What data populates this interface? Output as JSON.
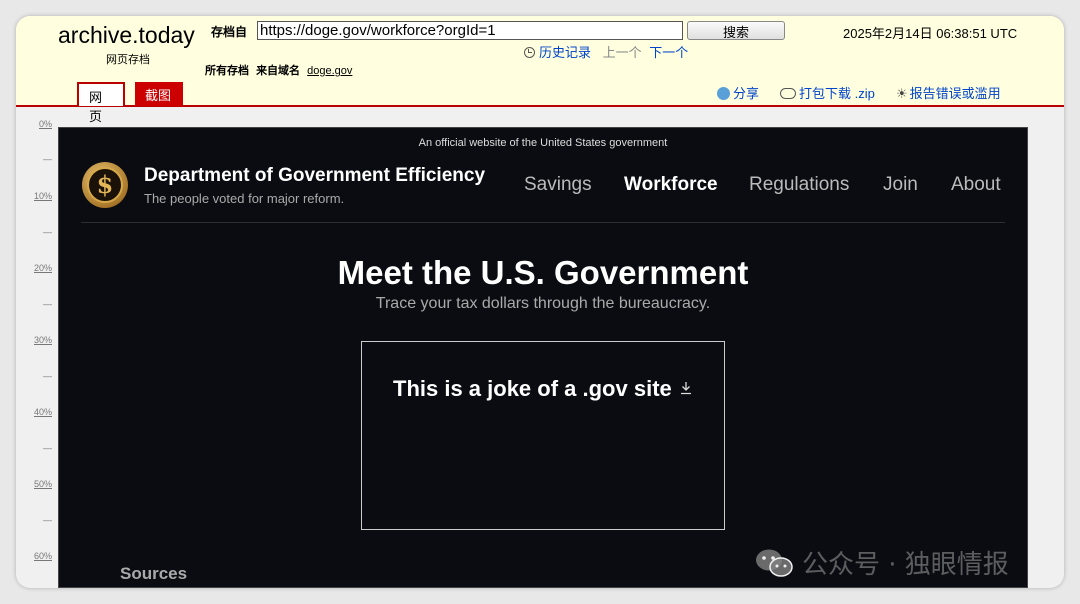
{
  "archive": {
    "brand": "archive.today",
    "brand_sub": "网页存档",
    "from_label": "存档自",
    "url": "https://doge.gov/workforce?orgId=1",
    "search_label": "搜索",
    "timestamp": "2025年2月14日 06:38:51 UTC",
    "history_label": "历史记录",
    "prev_label": "上一个",
    "next_label": "下一个",
    "all_archives_label": "所有存档",
    "from_domain_label": "来自域名",
    "domain": "doge.gov",
    "tabs": [
      {
        "label": "网页"
      },
      {
        "label": "截图"
      }
    ],
    "share_label": "分享",
    "download_label": "打包下载 .zip",
    "report_label": "报告错误或滥用"
  },
  "ruler": {
    "labels": [
      "0%",
      "10%",
      "20%",
      "30%",
      "40%",
      "50%",
      "60%"
    ],
    "dash": "—"
  },
  "site": {
    "banner": "An official website of the United States government",
    "logo_glyph": "$",
    "org_name": "Department of Government Efficiency",
    "tagline": "The people voted for major reform.",
    "nav": [
      {
        "label": "Savings"
      },
      {
        "label": "Workforce"
      },
      {
        "label": "Regulations"
      },
      {
        "label": "Join"
      },
      {
        "label": "About"
      }
    ],
    "hero_title": "Meet the U.S. Government",
    "hero_subtitle": "Trace your tax dollars through the bureaucracy.",
    "card_title": "This is a joke of a .gov site",
    "sources_label": "Sources"
  },
  "watermark": {
    "text": "公众号 · 独眼情报"
  },
  "colors": {
    "archive_bg": "#ffffe0",
    "archive_accent": "#cc0000",
    "link": "#0044cc",
    "site_bg": "#0a0c12"
  }
}
